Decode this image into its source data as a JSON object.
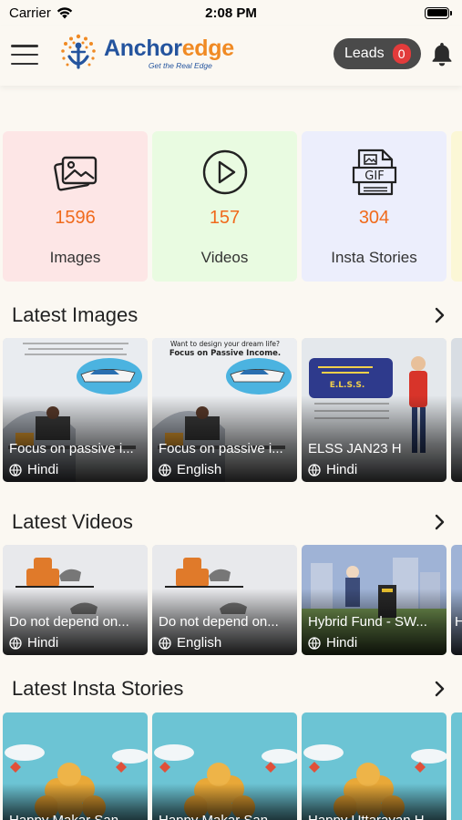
{
  "status_bar": {
    "carrier": "Carrier",
    "time": "2:08 PM"
  },
  "header": {
    "brand_anchor": "Anchor",
    "brand_edge": "edge",
    "tagline": "Get the Real Edge",
    "leads_label": "Leads",
    "leads_count": "0",
    "icons": [
      "menu-icon",
      "logo-icon",
      "bell-icon"
    ]
  },
  "stats": [
    {
      "count": "1596",
      "label": "Images",
      "icon": "images-icon",
      "bg": "#fde6e6"
    },
    {
      "count": "157",
      "label": "Videos",
      "icon": "play-icon",
      "bg": "#e9fbe1"
    },
    {
      "count": "304",
      "label": "Insta Stories",
      "icon": "gif-file-icon",
      "bg": "#eceefc"
    },
    {
      "count": "",
      "label": "",
      "icon": "",
      "bg": "#fbf7d6"
    }
  ],
  "sections": {
    "images": {
      "title": "Latest Images",
      "items": [
        {
          "title": "Focus on passive i...",
          "lang": "Hindi"
        },
        {
          "title": "Focus on passive i...",
          "lang": "English"
        },
        {
          "title": "ELSS JAN23 H",
          "lang": "Hindi"
        }
      ]
    },
    "videos": {
      "title": "Latest Videos",
      "items": [
        {
          "title": "Do not depend on...",
          "lang": "Hindi"
        },
        {
          "title": "Do not depend on...",
          "lang": "English"
        },
        {
          "title": "Hybrid Fund - SW...",
          "lang": "Hindi"
        },
        {
          "title": "H",
          "lang": ""
        }
      ]
    },
    "stories": {
      "title": "Latest Insta Stories",
      "items": [
        {
          "title": "Happy Makar San...",
          "lang": ""
        },
        {
          "title": "Happy Makar San...",
          "lang": ""
        },
        {
          "title": "Happy Uttarayan H...",
          "lang": ""
        }
      ]
    }
  },
  "image_card_texts": {
    "english_headline_1": "Want to design your dream life?",
    "english_headline_2": "Focus on Passive Income.",
    "elss_label": "E.L.S.S."
  },
  "colors": {
    "accent_orange": "#f06a1c",
    "brand_blue": "#24549e",
    "badge_red": "#e23b3b",
    "leads_bg": "#4a4a4a"
  }
}
